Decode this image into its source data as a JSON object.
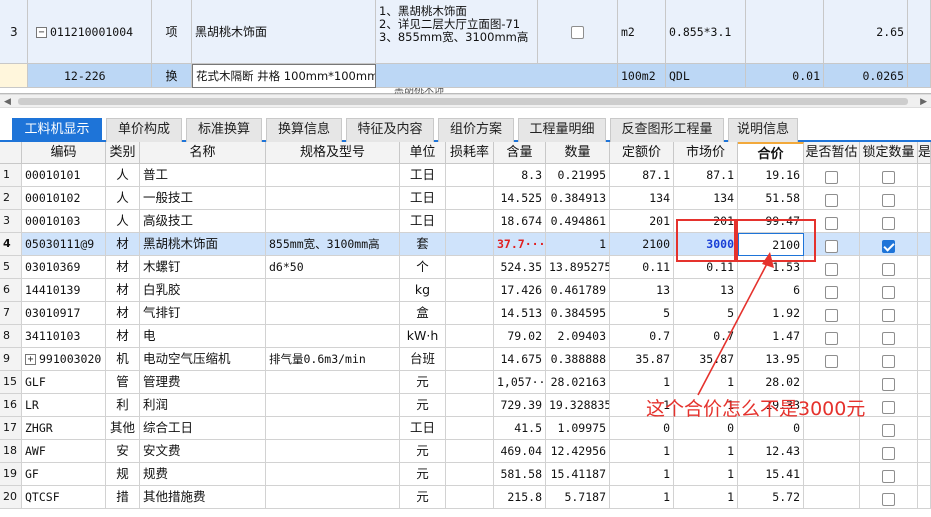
{
  "top_rows": [
    {
      "rownum": "3",
      "code": "011210001004",
      "kind": "项",
      "name": "黑胡桃木饰面",
      "features": [
        "1、黑胡桃木饰面",
        "2、详见二层大厅立面图-71",
        "3、855mm宽、3100mm高"
      ],
      "unit": "m2",
      "expr": "0.855*3.1",
      "qty": "",
      "total": "2.65"
    },
    {
      "code": "12-226",
      "kind": "换",
      "name": "花式木隔断 井格 100mm*100mm",
      "unit": "100m2",
      "expr": "QDL",
      "qty": "0.01",
      "total": "0.0265"
    }
  ],
  "partial_text": "黑胡桃木饰",
  "tabs": [
    "工料机显示",
    "单价构成",
    "标准换算",
    "换算信息",
    "特征及内容",
    "组价方案",
    "工程量明细",
    "反查图形工程量",
    "说明信息"
  ],
  "headers": [
    "",
    "编码",
    "类别",
    "名称",
    "规格及型号",
    "单位",
    "损耗率",
    "含量",
    "数量",
    "定额价",
    "市场价",
    "合价",
    "是否暂估",
    "锁定数量",
    "是"
  ],
  "rows": [
    {
      "n": "1",
      "code": "00010101",
      "cat": "人",
      "name": "普工",
      "spec": "",
      "unit": "工日",
      "loss": "",
      "content": "8.3",
      "qty": "0.21995",
      "base": "87.1",
      "market": "87.1",
      "total": "19.16",
      "est": false,
      "lock": false
    },
    {
      "n": "2",
      "code": "00010102",
      "cat": "人",
      "name": "一般技工",
      "spec": "",
      "unit": "工日",
      "loss": "",
      "content": "14.525",
      "qty": "0.384913",
      "base": "134",
      "market": "134",
      "total": "51.58",
      "est": false,
      "lock": false
    },
    {
      "n": "3",
      "code": "00010103",
      "cat": "人",
      "name": "高级技工",
      "spec": "",
      "unit": "工日",
      "loss": "",
      "content": "18.674",
      "qty": "0.494861",
      "base": "201",
      "market": "201",
      "total": "99.47",
      "est": false,
      "lock": false
    },
    {
      "n": "4",
      "code": "05030111@9",
      "cat": "材",
      "name": "黑胡桃木饰面",
      "spec": "855mm宽、3100mm高",
      "unit": "套",
      "loss": "",
      "content": "37.7···",
      "qty": "1",
      "base": "2100",
      "market": "3000",
      "total": "2100",
      "est": false,
      "lock": true
    },
    {
      "n": "5",
      "code": "03010369",
      "cat": "材",
      "name": "木螺钉",
      "spec": "d6*50",
      "unit": "个",
      "loss": "",
      "content": "524.35",
      "qty": "13.895275",
      "base": "0.11",
      "market": "0.11",
      "total": "1.53",
      "est": false,
      "lock": false
    },
    {
      "n": "6",
      "code": "14410139",
      "cat": "材",
      "name": "白乳胶",
      "spec": "",
      "unit": "kg",
      "loss": "",
      "content": "17.426",
      "qty": "0.461789",
      "base": "13",
      "market": "13",
      "total": "6",
      "est": false,
      "lock": false
    },
    {
      "n": "7",
      "code": "03010917",
      "cat": "材",
      "name": "气排钉",
      "spec": "",
      "unit": "盒",
      "loss": "",
      "content": "14.513",
      "qty": "0.384595",
      "base": "5",
      "market": "5",
      "total": "1.92",
      "est": false,
      "lock": false
    },
    {
      "n": "8",
      "code": "34110103",
      "cat": "材",
      "name": "电",
      "spec": "",
      "unit": "kW·h",
      "loss": "",
      "content": "79.02",
      "qty": "2.09403",
      "base": "0.7",
      "market": "0.7",
      "total": "1.47",
      "est": false,
      "lock": false
    },
    {
      "n": "9",
      "code": "991003020",
      "cat": "机",
      "name": "电动空气压缩机",
      "spec": "排气量0.6m3/min",
      "unit": "台班",
      "loss": "",
      "content": "14.675",
      "qty": "0.388888",
      "base": "35.87",
      "market": "35.87",
      "total": "13.95",
      "est": false,
      "lock": false
    },
    {
      "n": "15",
      "code": "GLF",
      "cat": "管",
      "name": "管理费",
      "spec": "",
      "unit": "元",
      "loss": "",
      "content": "1,057···",
      "qty": "28.02163",
      "base": "1",
      "market": "1",
      "total": "28.02",
      "est": null,
      "lock": false
    },
    {
      "n": "16",
      "code": "LR",
      "cat": "利",
      "name": "利润",
      "spec": "",
      "unit": "元",
      "loss": "",
      "content": "729.39",
      "qty": "19.328835",
      "base": "1",
      "market": "1",
      "total": "19.33",
      "est": null,
      "lock": false
    },
    {
      "n": "17",
      "code": "ZHGR",
      "cat": "其他",
      "name": "综合工日",
      "spec": "",
      "unit": "工日",
      "loss": "",
      "content": "41.5",
      "qty": "1.09975",
      "base": "0",
      "market": "0",
      "total": "0",
      "est": null,
      "lock": false
    },
    {
      "n": "18",
      "code": "AWF",
      "cat": "安",
      "name": "安文费",
      "spec": "",
      "unit": "元",
      "loss": "",
      "content": "469.04",
      "qty": "12.42956",
      "base": "1",
      "market": "1",
      "total": "12.43",
      "est": null,
      "lock": false
    },
    {
      "n": "19",
      "code": "GF",
      "cat": "规",
      "name": "规费",
      "spec": "",
      "unit": "元",
      "loss": "",
      "content": "581.58",
      "qty": "15.41187",
      "base": "1",
      "market": "1",
      "total": "15.41",
      "est": null,
      "lock": false
    },
    {
      "n": "20",
      "code": "QTCSF",
      "cat": "措",
      "name": "其他措施费",
      "spec": "",
      "unit": "元",
      "loss": "",
      "content": "215.8",
      "qty": "5.7187",
      "base": "1",
      "market": "1",
      "total": "5.72",
      "est": null,
      "lock": false
    }
  ],
  "annotation": "这个合价怎么不是3000元",
  "colors": {
    "accent": "#1e74d8",
    "selected_row": "#cfe3fb",
    "annotation_red": "#e5322d"
  }
}
